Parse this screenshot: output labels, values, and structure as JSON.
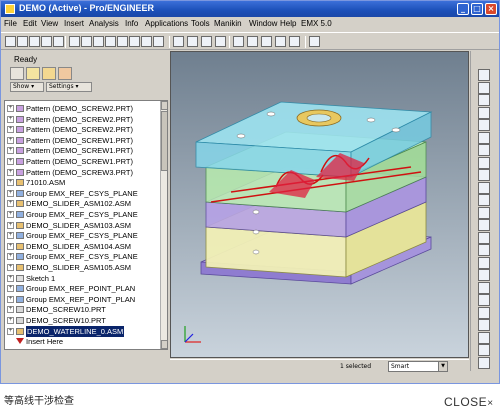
{
  "window": {
    "title": "DEMO (Active) - Pro/ENGINEER",
    "minimize": "_",
    "maximize": "□",
    "close": "×"
  },
  "menu": [
    "File",
    "Edit",
    "View",
    "Insert",
    "Analysis",
    "Info",
    "Applications",
    "Tools",
    "Manikin",
    "Window",
    "Help",
    "EMX 5.0"
  ],
  "left_panel": {
    "status": "Ready",
    "show_button": "Show ▾",
    "settings_button": "Settings ▾"
  },
  "tree": [
    {
      "label": "Pattern (DEMO_SCREW2.PRT)",
      "icon": "pattern-icon",
      "color": "#c8a0e0",
      "selected": false
    },
    {
      "label": "Pattern (DEMO_SCREW2.PRT)",
      "icon": "pattern-icon",
      "color": "#c8a0e0",
      "selected": false
    },
    {
      "label": "Pattern (DEMO_SCREW2.PRT)",
      "icon": "pattern-icon",
      "color": "#c8a0e0",
      "selected": false
    },
    {
      "label": "Pattern (DEMO_SCREW1.PRT)",
      "icon": "pattern-icon",
      "color": "#c8a0e0",
      "selected": false
    },
    {
      "label": "Pattern (DEMO_SCREW1.PRT)",
      "icon": "pattern-icon",
      "color": "#c8a0e0",
      "selected": false
    },
    {
      "label": "Pattern (DEMO_SCREW1.PRT)",
      "icon": "pattern-icon",
      "color": "#c8a0e0",
      "selected": false
    },
    {
      "label": "Pattern (DEMO_SCREW3.PRT)",
      "icon": "pattern-icon",
      "color": "#c8a0e0",
      "selected": false
    },
    {
      "label": "71010.ASM",
      "icon": "assembly-icon",
      "color": "#e8c070",
      "selected": false
    },
    {
      "label": "Group EMX_REF_CSYS_PLANE",
      "icon": "group-icon",
      "color": "#90b0e0",
      "selected": false
    },
    {
      "label": "DEMO_SLIDER_ASM102.ASM",
      "icon": "assembly-icon",
      "color": "#e8c070",
      "selected": false
    },
    {
      "label": "Group EMX_REF_CSYS_PLANE",
      "icon": "group-icon",
      "color": "#90b0e0",
      "selected": false
    },
    {
      "label": "DEMO_SLIDER_ASM103.ASM",
      "icon": "assembly-icon",
      "color": "#e8c070",
      "selected": false
    },
    {
      "label": "Group EMX_REF_CSYS_PLANE",
      "icon": "group-icon",
      "color": "#90b0e0",
      "selected": false
    },
    {
      "label": "DEMO_SLIDER_ASM104.ASM",
      "icon": "assembly-icon",
      "color": "#e8c070",
      "selected": false
    },
    {
      "label": "Group EMX_REF_CSYS_PLANE",
      "icon": "group-icon",
      "color": "#90b0e0",
      "selected": false
    },
    {
      "label": "DEMO_SLIDER_ASM105.ASM",
      "icon": "assembly-icon",
      "color": "#e8c070",
      "selected": false
    },
    {
      "label": "Sketch 1",
      "icon": "sketch-icon",
      "color": "#e0e0e0",
      "selected": false
    },
    {
      "label": "Group EMX_REF_POINT_PLAN",
      "icon": "group-icon",
      "color": "#90b0e0",
      "selected": false
    },
    {
      "label": "Group EMX_REF_POINT_PLAN",
      "icon": "group-icon",
      "color": "#90b0e0",
      "selected": false
    },
    {
      "label": "DEMO_SCREW10.PRT",
      "icon": "part-icon",
      "color": "#d8d8d8",
      "selected": false
    },
    {
      "label": "DEMO_SCREW10.PRT",
      "icon": "part-icon",
      "color": "#d8d8d8",
      "selected": false
    },
    {
      "label": "DEMO_WATERLINE_0.ASM",
      "icon": "assembly-icon",
      "color": "#e8c070",
      "selected": true
    },
    {
      "label": "Insert Here",
      "icon": "insert-here-icon",
      "color": "#c02020",
      "selected": false
    }
  ],
  "statusbar": {
    "selected_count": "1 selected",
    "filter": "Smart"
  },
  "caption": "等高线干涉检查",
  "close_link": "CLOSE",
  "close_icon": "×",
  "colors": {
    "title_bar": "#1b4fb8",
    "selection": "#0a246a",
    "viewport_top": "#6f7f8f"
  }
}
